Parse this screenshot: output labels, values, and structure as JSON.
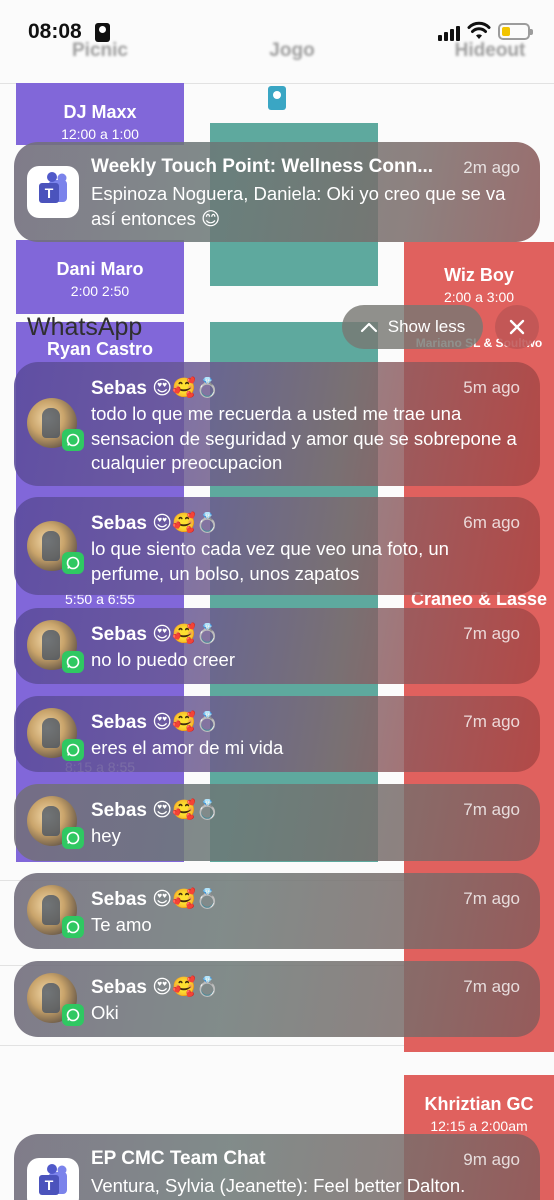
{
  "status_bar": {
    "time": "08:08"
  },
  "schedule": {
    "columns": [
      "Picnic",
      "Jogo",
      "Hideout"
    ],
    "blocks": [
      {
        "name": "DJ Maxx",
        "time": "12:00 a 1:00"
      },
      {
        "name": "Dani Maro",
        "time": "2:00 2:50"
      },
      {
        "name": "Wiz Boy",
        "time": "2:00 a 3:00"
      },
      {
        "name": "Ryan Castro",
        "time": ""
      },
      {
        "name": "Mariano SL & Soultwo",
        "time": ""
      },
      {
        "name": "Craneo & Lasse",
        "time": ""
      },
      {
        "name": "",
        "time": "5:50 a 6:55"
      },
      {
        "name": "",
        "time": "8:15 a 8:55"
      },
      {
        "name": "Khriztian GC",
        "time": "12:15 a 2:00am"
      }
    ]
  },
  "controls": {
    "group_title": "WhatsApp",
    "show_less": "Show less"
  },
  "notifications": {
    "teams_top": {
      "title": "Weekly Touch Point: Wellness Conn...",
      "time": "2m ago",
      "body": "Espinoza Noguera, Daniela: Oki yo creo que se va así entonces 😊"
    },
    "whatsapp": [
      {
        "sender": "Sebas",
        "emoji": "😍🥰💍",
        "time": "5m ago",
        "message": "todo lo que me recuerda a usted me trae una sensacion de seguridad y amor que se sobrepone a cualquier preocupacion"
      },
      {
        "sender": "Sebas",
        "emoji": "😍🥰💍",
        "time": "6m ago",
        "message": "lo que siento cada vez que veo una foto, un perfume, un bolso, unos zapatos"
      },
      {
        "sender": "Sebas",
        "emoji": "😍🥰💍",
        "time": "7m ago",
        "message": "no lo puedo creer"
      },
      {
        "sender": "Sebas",
        "emoji": "😍🥰💍",
        "time": "7m ago",
        "message": "eres el amor de mi vida"
      },
      {
        "sender": "Sebas",
        "emoji": "😍🥰💍",
        "time": "7m ago",
        "message": "hey"
      },
      {
        "sender": "Sebas",
        "emoji": "😍🥰💍",
        "time": "7m ago",
        "message": "Te amo"
      },
      {
        "sender": "Sebas",
        "emoji": "😍🥰💍",
        "time": "7m ago",
        "message": "Oki"
      }
    ],
    "teams_bottom": {
      "title": "EP CMC Team Chat",
      "time": "9m ago",
      "body": "Ventura, Sylvia (Jeanette): Feel better Dalton."
    }
  },
  "colors": {
    "purple_block": "#8167d9",
    "red_block": "#e0615e",
    "teal_block": "#5ea99e",
    "whatsapp_green": "#2fc862",
    "teams_purple": "#5059c9"
  },
  "icons": [
    "id-badge-icon",
    "signal-icon",
    "wifi-icon",
    "battery-icon",
    "teams-icon",
    "whatsapp-icon",
    "chevron-up-icon",
    "close-icon"
  ]
}
